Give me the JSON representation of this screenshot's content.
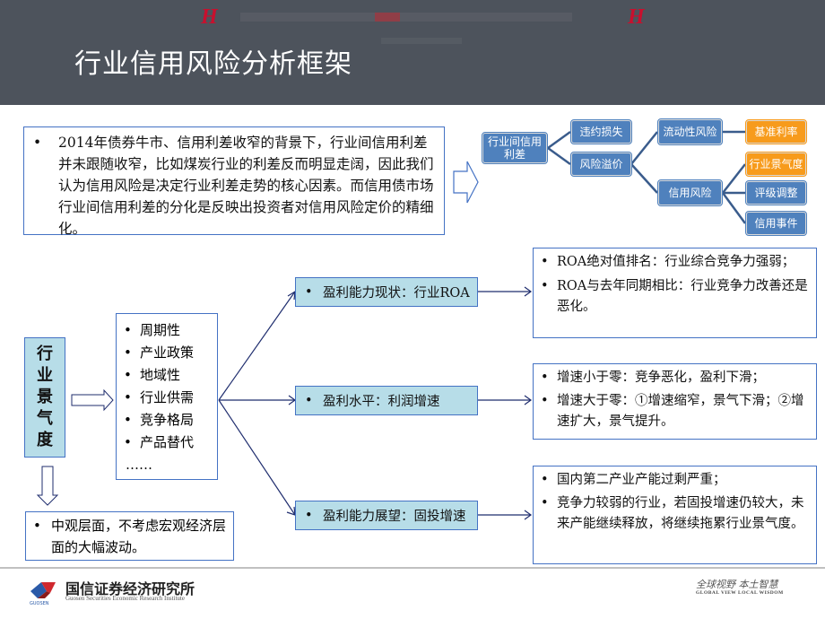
{
  "header": {
    "title": "行业信用风险分析框架",
    "watermark_text": "",
    "brand_mark": "H"
  },
  "intro": {
    "bullet": "•",
    "text": "2014年债券牛市、信用利差收窄的背景下，行业间信用利差并未跟随收窄，比如煤炭行业的利差反而明显走阔，因此我们认为信用风险是决定行业利差走势的核心因素。而信用债市场行业间信用利差的分化是反映出投资者对信用风险定价的精细化。"
  },
  "tree": {
    "root": "行业间信用利差",
    "level1": [
      "违约损失",
      "风险溢价"
    ],
    "level2": [
      "流动性风险",
      "信用风险"
    ],
    "level3": [
      {
        "label": "基准利率",
        "highlight": true
      },
      {
        "label": "行业景气度",
        "highlight": true
      },
      {
        "label": "评级调整",
        "highlight": false
      },
      {
        "label": "信用事件",
        "highlight": false
      }
    ],
    "colors": {
      "node": "#4f81bd",
      "highlight": "#f79b1c"
    }
  },
  "factor": {
    "chars": [
      "行",
      "业",
      "景",
      "气",
      "度"
    ]
  },
  "factor_list": {
    "items": [
      "周期性",
      "产业政策",
      "地域性",
      "行业供需",
      "竞争格局",
      "产品替代"
    ],
    "ellipsis": "……"
  },
  "meso": {
    "text": "中观层面，不考虑宏观经济层面的大幅波动。"
  },
  "indicators": [
    {
      "label": "盈利能力现状：行业ROA",
      "details": [
        "ROA绝对值排名：行业综合竞争力强弱；",
        "ROA与去年同期相比：行业竞争力改善还是恶化。"
      ]
    },
    {
      "label": "盈利水平：利润增速",
      "details": [
        "增速小于零：竞争恶化，盈利下滑；",
        "增速大于零：①增速缩窄，景气下滑；②增速扩大，景气提升。"
      ]
    },
    {
      "label": "盈利能力展望：固投增速",
      "details": [
        "国内第二产业产能过剩严重；",
        "竞争力较弱的行业，若固投增速仍较大，未来产能继续释放，将继续拖累行业景气度。"
      ]
    }
  ],
  "footer": {
    "org_name": "国信证券经济研究所",
    "org_name_en": "Guosen Securities Economic Research Institute",
    "logo_text": "GUOSEN",
    "slogan": "全球视野  本土智慧",
    "slogan_en": "GLOBAL VIEW   LOCAL WISDOM"
  },
  "bullet": "•"
}
